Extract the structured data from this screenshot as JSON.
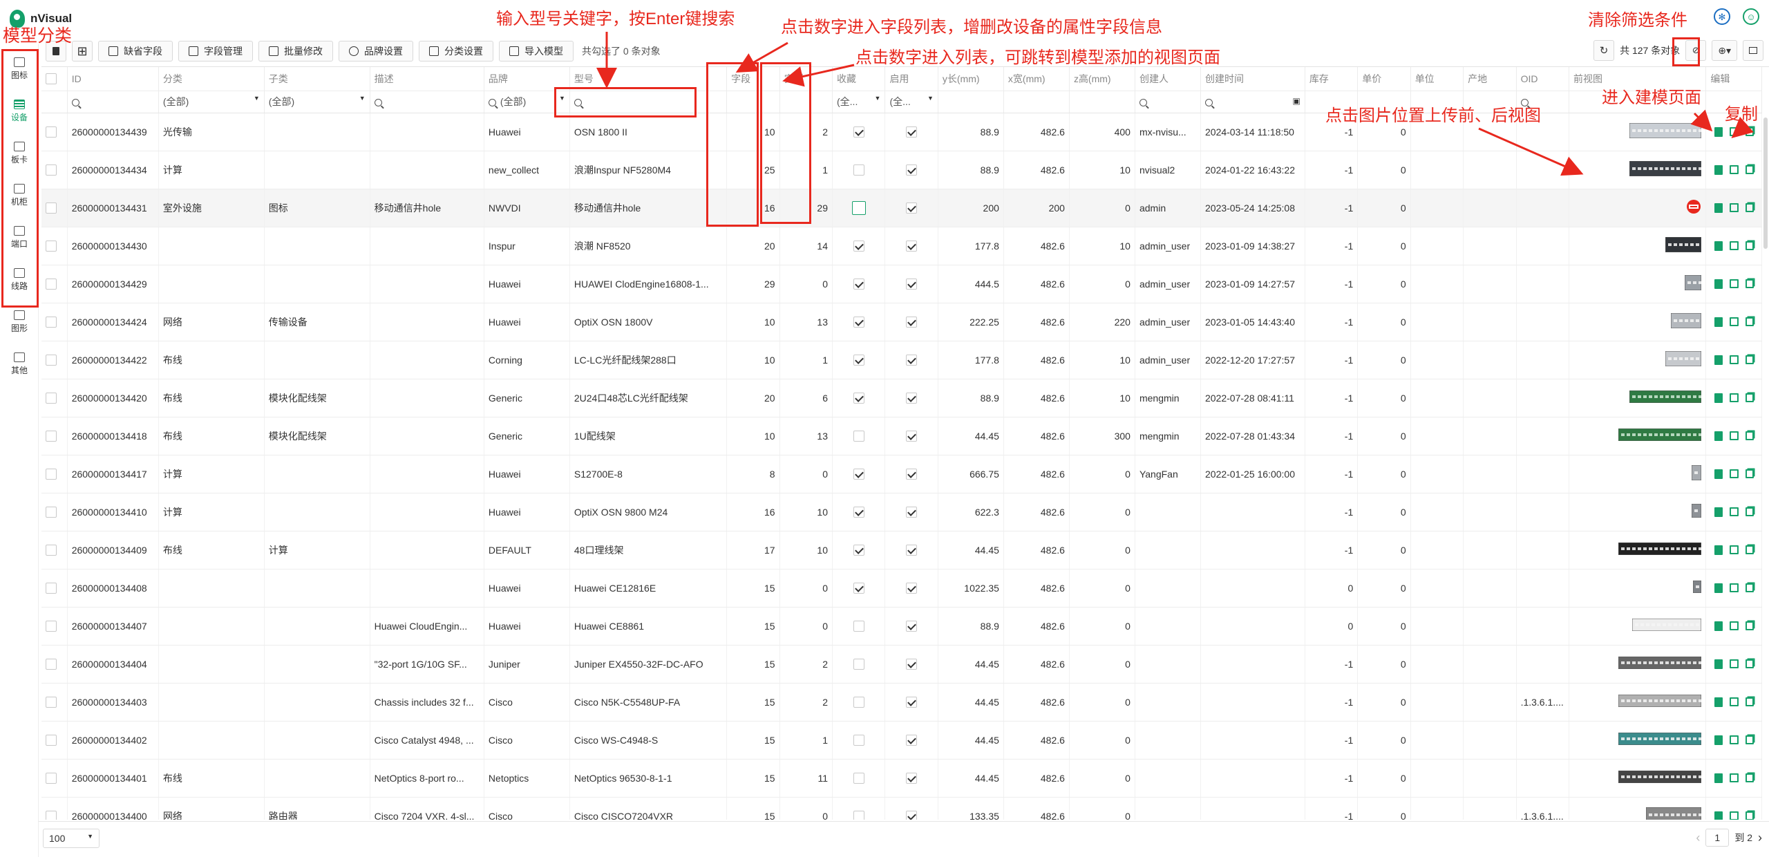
{
  "app": {
    "name": "nVisual"
  },
  "sidebar": {
    "items": [
      {
        "label": "图标",
        "active": false
      },
      {
        "label": "设备",
        "active": true
      },
      {
        "label": "板卡",
        "active": false
      },
      {
        "label": "机柜",
        "active": false
      },
      {
        "label": "端口",
        "active": false
      },
      {
        "label": "线路",
        "active": false
      },
      {
        "label": "图形",
        "active": false
      },
      {
        "label": "其他",
        "active": false
      }
    ]
  },
  "toolbar": {
    "buttons": [
      "缺省字段",
      "字段管理",
      "批量修改",
      "品牌设置",
      "分类设置",
      "导入模型"
    ],
    "selection_text": "共勾选了 0 条对象",
    "total_text": "共 127 条对象"
  },
  "table": {
    "columns": [
      "ID",
      "分类",
      "子类",
      "描述",
      "品牌",
      "型号",
      "字段",
      "实例",
      "收藏",
      "启用",
      "y长(mm)",
      "x宽(mm)",
      "z高(mm)",
      "创建人",
      "创建时间",
      "库存",
      "单价",
      "单位",
      "产地",
      "OID",
      "前视图",
      "编辑"
    ],
    "filters": {
      "category": "(全部)",
      "subcategory": "(全部)",
      "brand": "(全部)",
      "fav": "(全...",
      "enabled": "(全..."
    },
    "rows": [
      {
        "id": "26000000134439",
        "cat": "光传输",
        "sub": "",
        "desc": "",
        "brand": "Huawei",
        "model": "OSN 1800 II",
        "fields": "10",
        "inst": "2",
        "fav": true,
        "en": true,
        "y": "88.9",
        "x": "482.6",
        "z": "400",
        "creator": "mx-nvisu...",
        "time": "2024-03-14 11:18:50",
        "stock": "-1",
        "price": "0",
        "unit": "",
        "origin": "",
        "oid": "",
        "thumb": "osn"
      },
      {
        "id": "26000000134434",
        "cat": "计算",
        "sub": "",
        "desc": "",
        "brand": "new_collect",
        "model": "浪潮Inspur NF5280M4",
        "fields": "25",
        "inst": "1",
        "fav": false,
        "en": true,
        "y": "88.9",
        "x": "482.6",
        "z": "10",
        "creator": "nvisual2",
        "time": "2024-01-22 16:43:22",
        "stock": "-1",
        "price": "0",
        "unit": "",
        "origin": "",
        "oid": "",
        "thumb": "server2u"
      },
      {
        "id": "26000000134431",
        "cat": "室外设施",
        "sub": "图标",
        "desc": "移动通信井hole",
        "brand": "NWVDI",
        "model": "移动通信井hole",
        "fields": "16",
        "inst": "29",
        "fav": false,
        "en": true,
        "y": "200",
        "x": "200",
        "z": "0",
        "creator": "admin",
        "time": "2023-05-24 14:25:08",
        "stock": "-1",
        "price": "0",
        "unit": "",
        "origin": "",
        "oid": "",
        "thumb": "hole",
        "highlight": true
      },
      {
        "id": "26000000134430",
        "cat": "",
        "sub": "",
        "desc": "",
        "brand": "Inspur",
        "model": "浪潮 NF8520",
        "fields": "20",
        "inst": "14",
        "fav": true,
        "en": true,
        "y": "177.8",
        "x": "482.6",
        "z": "10",
        "creator": "admin_user",
        "time": "2023-01-09 14:38:27",
        "stock": "-1",
        "price": "0",
        "unit": "",
        "origin": "",
        "oid": "",
        "thumb": "server4u"
      },
      {
        "id": "26000000134429",
        "cat": "",
        "sub": "",
        "desc": "",
        "brand": "Huawei",
        "model": "HUAWEI ClodEngine16808-1...",
        "fields": "29",
        "inst": "0",
        "fav": true,
        "en": true,
        "y": "444.5",
        "x": "482.6",
        "z": "0",
        "creator": "admin_user",
        "time": "2023-01-09 14:27:57",
        "stock": "-1",
        "price": "0",
        "unit": "",
        "origin": "",
        "oid": "",
        "thumb": "tall"
      },
      {
        "id": "26000000134424",
        "cat": "网络",
        "sub": "传输设备",
        "desc": "",
        "brand": "Huawei",
        "model": "OptiX OSN 1800V",
        "fields": "10",
        "inst": "13",
        "fav": true,
        "en": true,
        "y": "222.25",
        "x": "482.6",
        "z": "220",
        "creator": "admin_user",
        "time": "2023-01-05 14:43:40",
        "stock": "-1",
        "price": "0",
        "unit": "",
        "origin": "",
        "oid": "",
        "thumb": "box"
      },
      {
        "id": "26000000134422",
        "cat": "布线",
        "sub": "",
        "desc": "",
        "brand": "Corning",
        "model": "LC-LC光纤配线架288口",
        "fields": "10",
        "inst": "1",
        "fav": true,
        "en": true,
        "y": "177.8",
        "x": "482.6",
        "z": "10",
        "creator": "admin_user",
        "time": "2022-12-20 17:27:57",
        "stock": "-1",
        "price": "0",
        "unit": "",
        "origin": "",
        "oid": "",
        "thumb": "box2"
      },
      {
        "id": "26000000134420",
        "cat": "布线",
        "sub": "模块化配线架",
        "desc": "",
        "brand": "Generic",
        "model": "2U24口48芯LC光纤配线架",
        "fields": "20",
        "inst": "6",
        "fav": true,
        "en": true,
        "y": "88.9",
        "x": "482.6",
        "z": "10",
        "creator": "mengmin",
        "time": "2022-07-28 08:41:11",
        "stock": "-1",
        "price": "0",
        "unit": "",
        "origin": "",
        "oid": "",
        "thumb": "greenpanel"
      },
      {
        "id": "26000000134418",
        "cat": "布线",
        "sub": "模块化配线架",
        "desc": "",
        "brand": "Generic",
        "model": "1U配线架",
        "fields": "10",
        "inst": "13",
        "fav": false,
        "en": true,
        "y": "44.45",
        "x": "482.6",
        "z": "300",
        "creator": "mengmin",
        "time": "2022-07-28 01:43:34",
        "stock": "-1",
        "price": "0",
        "unit": "",
        "origin": "",
        "oid": "",
        "thumb": "greenpanel2"
      },
      {
        "id": "26000000134417",
        "cat": "计算",
        "sub": "",
        "desc": "",
        "brand": "Huawei",
        "model": "S12700E-8",
        "fields": "8",
        "inst": "0",
        "fav": true,
        "en": true,
        "y": "666.75",
        "x": "482.6",
        "z": "0",
        "creator": "YangFan",
        "time": "2022-01-25 16:00:00",
        "stock": "-1",
        "price": "0",
        "unit": "",
        "origin": "",
        "oid": "",
        "thumb": "small"
      },
      {
        "id": "26000000134410",
        "cat": "计算",
        "sub": "",
        "desc": "",
        "brand": "Huawei",
        "model": "OptiX OSN 9800 M24",
        "fields": "16",
        "inst": "10",
        "fav": true,
        "en": true,
        "y": "622.3",
        "x": "482.6",
        "z": "0",
        "creator": "",
        "time": "",
        "stock": "-1",
        "price": "0",
        "unit": "",
        "origin": "",
        "oid": "",
        "thumb": "small2"
      },
      {
        "id": "26000000134409",
        "cat": "布线",
        "sub": "计算",
        "desc": "",
        "brand": "DEFAULT",
        "model": "48口理线架",
        "fields": "17",
        "inst": "10",
        "fav": true,
        "en": true,
        "y": "44.45",
        "x": "482.6",
        "z": "0",
        "creator": "",
        "time": "",
        "stock": "-1",
        "price": "0",
        "unit": "",
        "origin": "",
        "oid": "",
        "thumb": "blackpanel"
      },
      {
        "id": "26000000134408",
        "cat": "",
        "sub": "",
        "desc": "",
        "brand": "Huawei",
        "model": "Huawei CE12816E",
        "fields": "15",
        "inst": "0",
        "fav": true,
        "en": true,
        "y": "1022.35",
        "x": "482.6",
        "z": "0",
        "creator": "",
        "time": "",
        "stock": "0",
        "price": "0",
        "unit": "",
        "origin": "",
        "oid": "",
        "thumb": "small3"
      },
      {
        "id": "26000000134407",
        "cat": "",
        "sub": "",
        "desc": "Huawei CloudEngin...",
        "brand": "Huawei",
        "model": "Huawei CE8861",
        "fields": "15",
        "inst": "0",
        "fav": false,
        "en": true,
        "y": "88.9",
        "x": "482.6",
        "z": "0",
        "creator": "",
        "time": "",
        "stock": "0",
        "price": "0",
        "unit": "",
        "origin": "",
        "oid": "",
        "thumb": "whiteline"
      },
      {
        "id": "26000000134404",
        "cat": "",
        "sub": "",
        "desc": "\"32-port 1G/10G SF...",
        "brand": "Juniper",
        "model": "Juniper EX4550-32F-DC-AFO",
        "fields": "15",
        "inst": "2",
        "fav": false,
        "en": true,
        "y": "44.45",
        "x": "482.6",
        "z": "0",
        "creator": "",
        "time": "",
        "stock": "-1",
        "price": "0",
        "unit": "",
        "origin": "",
        "oid": "",
        "thumb": "switch"
      },
      {
        "id": "26000000134403",
        "cat": "",
        "sub": "",
        "desc": "Chassis includes 32 f...",
        "brand": "Cisco",
        "model": "Cisco N5K-C5548UP-FA",
        "fields": "15",
        "inst": "2",
        "fav": false,
        "en": true,
        "y": "44.45",
        "x": "482.6",
        "z": "0",
        "creator": "",
        "time": "",
        "stock": "-1",
        "price": "0",
        "unit": "",
        "origin": "",
        "oid": ".1.3.6.1....",
        "thumb": "switch2"
      },
      {
        "id": "26000000134402",
        "cat": "",
        "sub": "",
        "desc": "Cisco Catalyst 4948, ...",
        "brand": "Cisco",
        "model": "Cisco WS-C4948-S",
        "fields": "15",
        "inst": "1",
        "fav": false,
        "en": true,
        "y": "44.45",
        "x": "482.6",
        "z": "0",
        "creator": "",
        "time": "",
        "stock": "-1",
        "price": "0",
        "unit": "",
        "origin": "",
        "oid": "",
        "thumb": "switch3"
      },
      {
        "id": "26000000134401",
        "cat": "布线",
        "sub": "",
        "desc": "NetOptics 8-port ro...",
        "brand": "Netoptics",
        "model": "NetOptics 96530-8-1-1",
        "fields": "15",
        "inst": "11",
        "fav": false,
        "en": true,
        "y": "44.45",
        "x": "482.6",
        "z": "0",
        "creator": "",
        "time": "",
        "stock": "-1",
        "price": "0",
        "unit": "",
        "origin": "",
        "oid": "",
        "thumb": "switch4"
      },
      {
        "id": "26000000134400",
        "cat": "网络",
        "sub": "路由器",
        "desc": "Cisco 7204 VXR, 4-sl...",
        "brand": "Cisco",
        "model": "Cisco CISCO7204VXR",
        "fields": "15",
        "inst": "0",
        "fav": false,
        "en": true,
        "y": "133.35",
        "x": "482.6",
        "z": "0",
        "creator": "",
        "time": "",
        "stock": "-1",
        "price": "0",
        "unit": "",
        "origin": "",
        "oid": ".1.3.6.1....",
        "thumb": "router"
      }
    ]
  },
  "pagination": {
    "page_size": "100",
    "current_page": "1",
    "total_pages_text": "到 2"
  },
  "annotations": {
    "model_category": "模型分类",
    "search_hint": "输入型号关键字，按Enter键搜索",
    "fields_hint": "点击数字进入字段列表，增删改设备的属性字段信息",
    "instances_hint": "点击数字进入列表，可跳转到模型添加的视图页面",
    "clear_filter": "清除筛选条件",
    "enter_modeling": "进入建模页面",
    "copy": "复制",
    "upload_views": "点击图片位置上传前、后视图"
  },
  "colors": {
    "accent": "#15a06a",
    "annotation": "#e8281e"
  }
}
